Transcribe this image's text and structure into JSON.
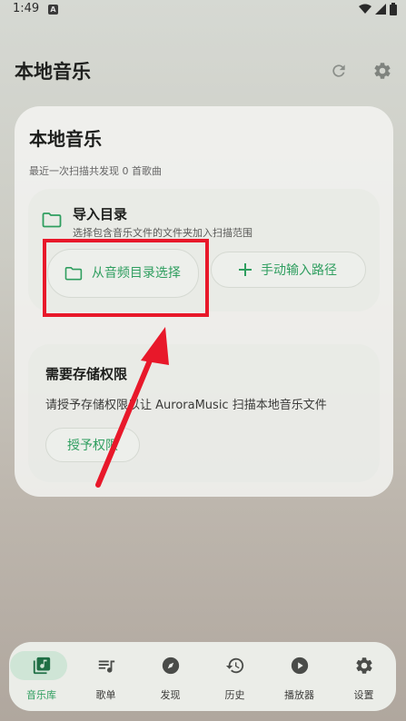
{
  "status_bar": {
    "time": "1:49",
    "notification_badge": "A"
  },
  "header": {
    "title": "本地音乐",
    "refresh_icon": "refresh-icon",
    "settings_icon": "gear-icon"
  },
  "main_card": {
    "title": "本地音乐",
    "scan_summary": "最近一次扫描共发现 0 首歌曲",
    "import": {
      "title": "导入目录",
      "description": "选择包含音乐文件的文件夹加入扫描范围",
      "select_button": "从音频目录选择",
      "manual_button": "手动输入路径"
    },
    "permission": {
      "title": "需要存储权限",
      "description": "请授予存储权限以让 AuroraMusic 扫描本地音乐文件",
      "grant_button": "授予权限"
    }
  },
  "bottom_nav": {
    "items": [
      {
        "label": "音乐库",
        "icon": "music-library-icon",
        "active": true
      },
      {
        "label": "歌单",
        "icon": "playlist-icon",
        "active": false
      },
      {
        "label": "发现",
        "icon": "compass-icon",
        "active": false
      },
      {
        "label": "历史",
        "icon": "history-icon",
        "active": false
      },
      {
        "label": "播放器",
        "icon": "play-circle-icon",
        "active": false
      },
      {
        "label": "设置",
        "icon": "gear-icon",
        "active": false
      }
    ]
  },
  "colors": {
    "accent": "#2f9e5f",
    "annotation": "#e8182a",
    "active_nav_bg": "#cfe5d6"
  }
}
